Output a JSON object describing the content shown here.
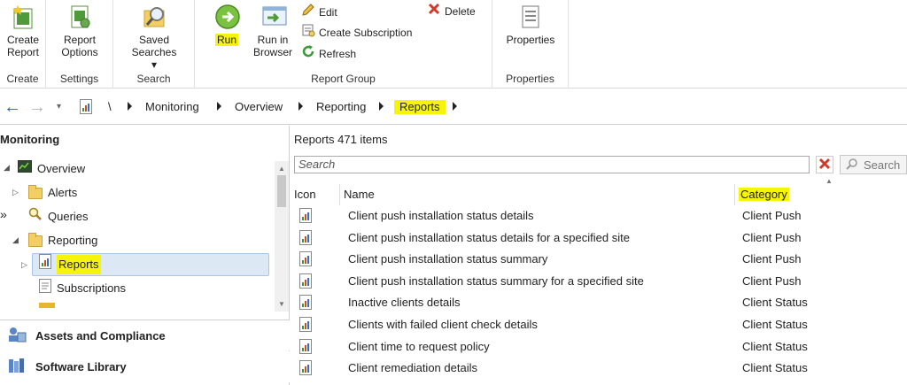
{
  "ribbon": {
    "create": {
      "button": "Create Report",
      "group": "Create"
    },
    "settings": {
      "button": "Report Options",
      "group": "Settings"
    },
    "search": {
      "button": "Saved Searches",
      "dropdown_glyph": "▾",
      "group": "Search"
    },
    "report_group": {
      "run": "Run",
      "run_in_browser": "Run in Browser",
      "edit": "Edit",
      "create_subscription": "Create Subscription",
      "refresh": "Refresh",
      "delete": "Delete",
      "group": "Report Group"
    },
    "properties": {
      "button": "Properties",
      "group": "Properties"
    }
  },
  "address_bar": {
    "back_glyph": "←",
    "forward_glyph": "→",
    "history_glyph": "▾",
    "root": "\\",
    "crumbs": [
      "Monitoring",
      "Overview",
      "Reporting",
      "Reports"
    ]
  },
  "left_panel": {
    "title": "Monitoring",
    "collapse_glyph": "»",
    "tree": {
      "overview": "Overview",
      "alerts": "Alerts",
      "queries": "Queries",
      "reporting": "Reporting",
      "reports": "Reports",
      "subscriptions": "Subscriptions"
    },
    "workspaces": [
      "Assets and Compliance",
      "Software Library"
    ]
  },
  "main": {
    "title": "Reports 471 items",
    "search_placeholder": "Search",
    "search_button": "Search",
    "columns": {
      "icon": "Icon",
      "name": "Name",
      "category": "Category"
    },
    "rows": [
      {
        "name": "Client push installation status details",
        "category": "Client Push"
      },
      {
        "name": "Client push installation status details for a specified site",
        "category": "Client Push"
      },
      {
        "name": "Client push installation status summary",
        "category": "Client Push"
      },
      {
        "name": "Client push installation status summary for a specified site",
        "category": "Client Push"
      },
      {
        "name": "Inactive clients details",
        "category": "Client Status"
      },
      {
        "name": "Clients with failed client check details",
        "category": "Client Status"
      },
      {
        "name": "Client time to request policy",
        "category": "Client Status"
      },
      {
        "name": "Client remediation details",
        "category": "Client Status"
      }
    ]
  },
  "colors": {
    "highlight": "#f6f40a",
    "selection_bg": "#dde8f5",
    "selection_border": "#a8c4e6"
  }
}
